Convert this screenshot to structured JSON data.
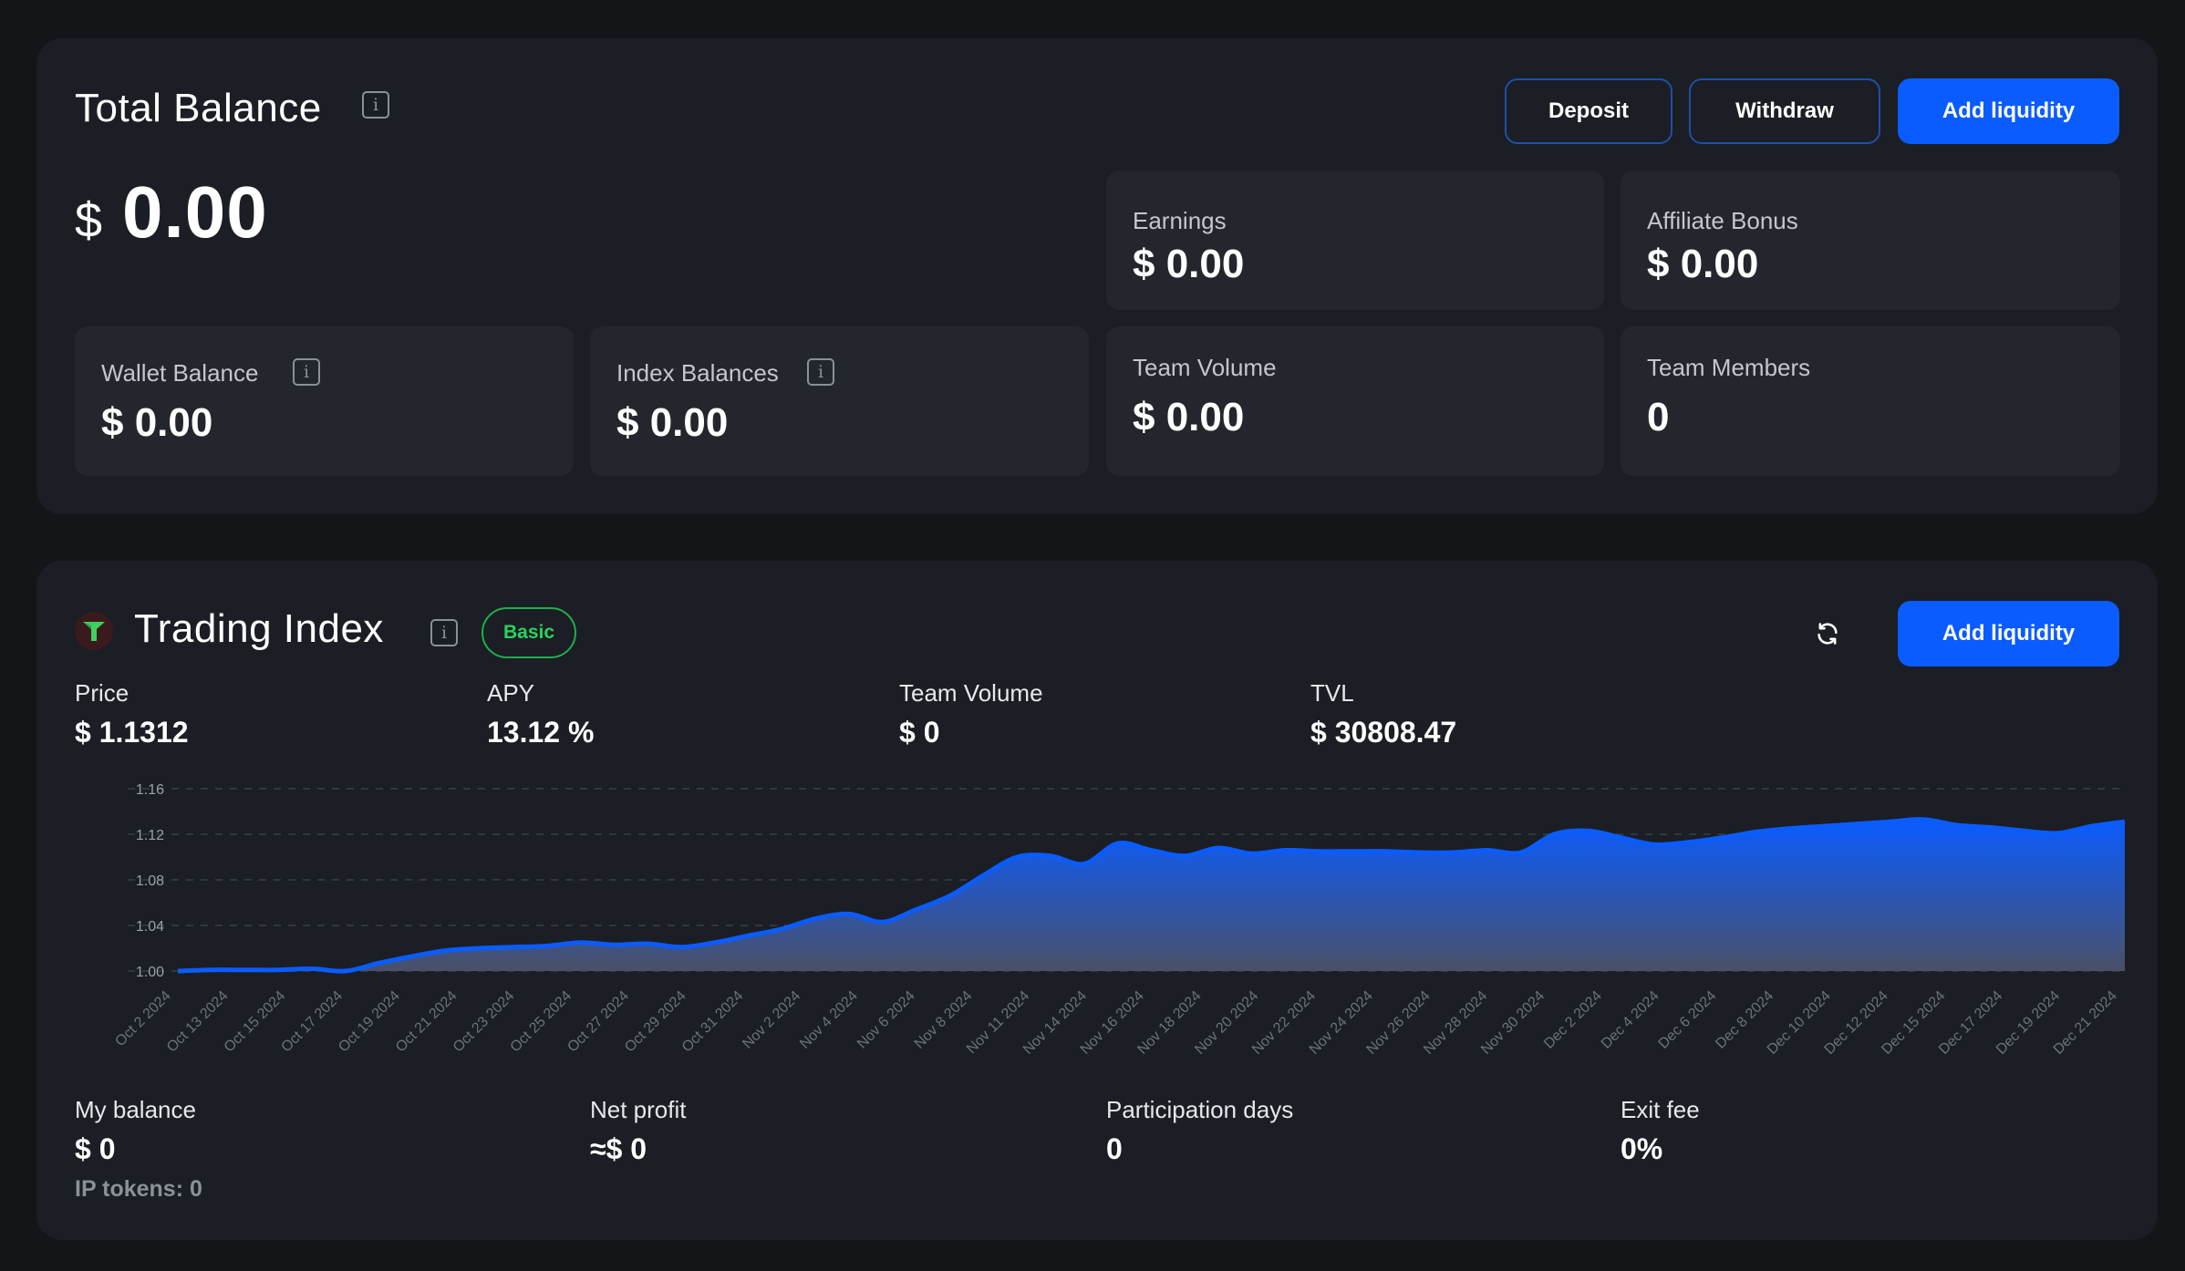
{
  "balance_card": {
    "title": "Total Balance",
    "currency": "$",
    "total": "0.00",
    "buttons": {
      "deposit": "Deposit",
      "withdraw": "Withdraw",
      "add_liquidity": "Add liquidity"
    },
    "stats": {
      "earnings": {
        "label": "Earnings",
        "value": "$ 0.00"
      },
      "affiliate": {
        "label": "Affiliate Bonus",
        "value": "$ 0.00"
      },
      "wallet": {
        "label": "Wallet Balance",
        "value": "$ 0.00"
      },
      "index_balances": {
        "label": "Index Balances",
        "value": "$ 0.00"
      },
      "team_volume": {
        "label": "Team Volume",
        "value": "$ 0.00"
      },
      "team_members": {
        "label": "Team Members",
        "value": "0"
      }
    }
  },
  "index_card": {
    "title": "Trading Index",
    "badge": "Basic",
    "add_liquidity": "Add liquidity",
    "metrics": {
      "price": {
        "label": "Price",
        "value": "$ 1.1312"
      },
      "apy": {
        "label": "APY",
        "value": "13.12 %"
      },
      "team_volume": {
        "label": "Team Volume",
        "value": "$ 0"
      },
      "tvl": {
        "label": "TVL",
        "value": "$ 30808.47"
      }
    },
    "footer": {
      "my_balance": {
        "label": "My balance",
        "value": "$ 0",
        "sub": "IP tokens: 0"
      },
      "net_profit": {
        "label": "Net profit",
        "value": "≈$ 0"
      },
      "participation": {
        "label": "Participation days",
        "value": "0"
      },
      "exit_fee": {
        "label": "Exit fee",
        "value": "0%"
      }
    }
  },
  "colors": {
    "accent": "#0a5cff",
    "badge_green": "#28d35c",
    "card_bg": "#1b1e24",
    "tile_bg": "#23262d"
  },
  "icons": [
    "info-icon",
    "trading-index-logo-icon",
    "refresh-icon"
  ],
  "chart_data": {
    "type": "area",
    "ylim": [
      1.0,
      1.16
    ],
    "yticks": [
      "1.16",
      "1.12",
      "1.08",
      "1.04",
      "1.00"
    ],
    "grid": true,
    "x_tick_labels": [
      "Oct 2 2024",
      "Oct 13 2024",
      "Oct 15 2024",
      "Oct 17 2024",
      "Oct 19 2024",
      "Oct 21 2024",
      "Oct 23 2024",
      "Oct 25 2024",
      "Oct 27 2024",
      "Oct 29 2024",
      "Oct 31 2024",
      "Nov 2 2024",
      "Nov 4 2024",
      "Nov 6 2024",
      "Nov 8 2024",
      "Nov 11 2024",
      "Nov 14 2024",
      "Nov 16 2024",
      "Nov 18 2024",
      "Nov 20 2024",
      "Nov 22 2024",
      "Nov 24 2024",
      "Nov 26 2024",
      "Nov 28 2024",
      "Nov 30 2024",
      "Dec 2 2024",
      "Dec 4 2024",
      "Dec 6 2024",
      "Dec 8 2024",
      "Dec 10 2024",
      "Dec 12 2024",
      "Dec 15 2024",
      "Dec 17 2024",
      "Dec 19 2024",
      "Dec 21 2024"
    ],
    "values": [
      1.0,
      1.001,
      1.001,
      1.001,
      1.002,
      1.0,
      1.007,
      1.013,
      1.018,
      1.02,
      1.021,
      1.022,
      1.025,
      1.023,
      1.024,
      1.021,
      1.025,
      1.031,
      1.037,
      1.046,
      1.05,
      1.043,
      1.054,
      1.066,
      1.084,
      1.1,
      1.101,
      1.094,
      1.112,
      1.106,
      1.101,
      1.108,
      1.103,
      1.106,
      1.105,
      1.105,
      1.105,
      1.104,
      1.104,
      1.106,
      1.104,
      1.12,
      1.123,
      1.117,
      1.111,
      1.113,
      1.117,
      1.122,
      1.125,
      1.127,
      1.129,
      1.131,
      1.133,
      1.128,
      1.126,
      1.123,
      1.121,
      1.127,
      1.131
    ]
  }
}
